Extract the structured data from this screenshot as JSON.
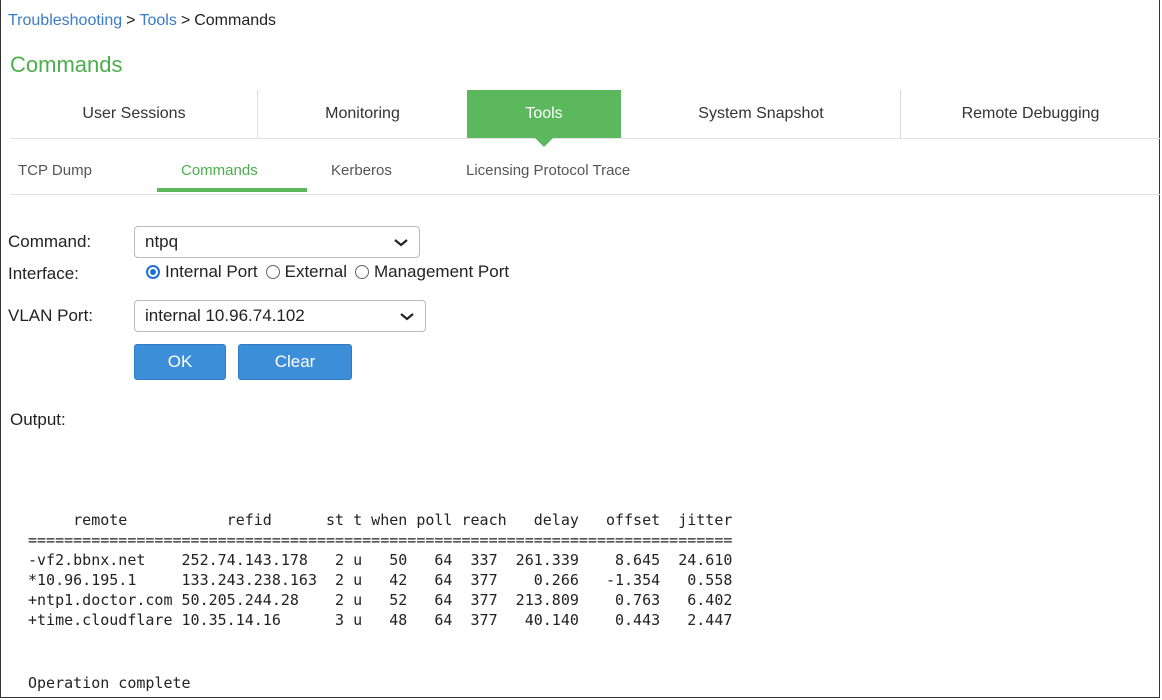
{
  "breadcrumb": {
    "items": [
      "Troubleshooting",
      "Tools",
      "Commands"
    ],
    "separator": ">"
  },
  "page_title": "Commands",
  "main_tabs": [
    {
      "label": "User Sessions",
      "active": false
    },
    {
      "label": "Monitoring",
      "active": false
    },
    {
      "label": "Tools",
      "active": true
    },
    {
      "label": "System Snapshot",
      "active": false
    },
    {
      "label": "Remote Debugging",
      "active": false
    }
  ],
  "sub_tabs": [
    {
      "label": "TCP Dump",
      "active": false
    },
    {
      "label": "Commands",
      "active": true
    },
    {
      "label": "Kerberos",
      "active": false
    },
    {
      "label": "Licensing Protocol Trace",
      "active": false
    }
  ],
  "form": {
    "command_label": "Command:",
    "command_value": "ntpq",
    "interface_label": "Interface:",
    "interface_options": [
      {
        "label": "Internal Port",
        "checked": true
      },
      {
        "label": "External",
        "checked": false
      },
      {
        "label": "Management Port",
        "checked": false
      }
    ],
    "vlan_label": "VLAN Port:",
    "vlan_value": "internal 10.96.74.102",
    "ok_label": "OK",
    "clear_label": "Clear"
  },
  "output": {
    "label": "Output:",
    "header": "     remote           refid      st t when poll reach   delay   offset  jitter",
    "rule": "==============================================================================",
    "rows": [
      "-vf2.bbnx.net    252.74.143.178   2 u   50   64  337  261.339    8.645  24.610",
      "*10.96.195.1     133.243.238.163  2 u   42   64  377    0.266   -1.354   0.558",
      "+ntp1.doctor.com 50.205.244.28    2 u   52   64  377  213.809    0.763   6.402",
      "+time.cloudflare 10.35.14.16      3 u   48   64  377   40.140    0.443   2.447"
    ],
    "status": "Operation complete"
  },
  "colors": {
    "accent_green": "#5cb85c",
    "link_blue": "#3a7bc8",
    "button_blue": "#3d8ed8"
  }
}
